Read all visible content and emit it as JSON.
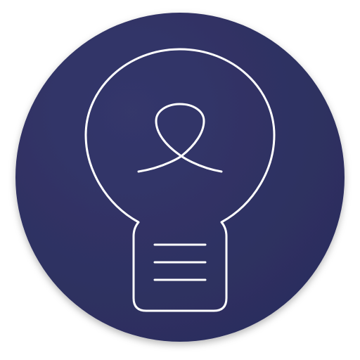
{
  "app_icon": {
    "icon": "lightbulb-icon",
    "badge_shape": "circle",
    "colors": {
      "background": "#2c2e5e",
      "background_highlight": "#34376b",
      "stroke": "#ffffff"
    }
  }
}
